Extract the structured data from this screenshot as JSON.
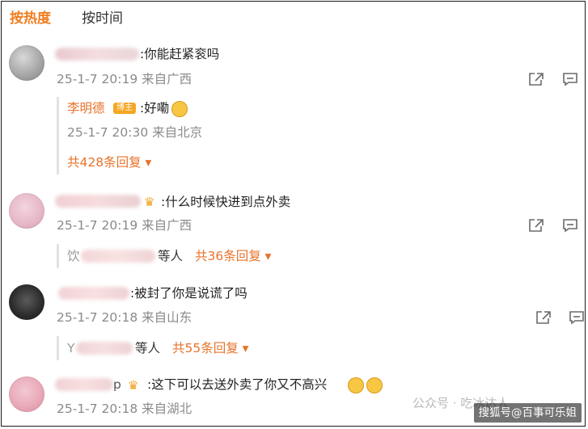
{
  "tabs": {
    "hot": "按热度",
    "time": "按时间"
  },
  "comments": [
    {
      "text": ":你能赶紧衮吗",
      "meta": "25-1-7 20:19 来自广西",
      "reply": {
        "name": "李明德",
        "badge": "博主",
        "text": ":好嘞",
        "meta": "25-1-7 20:30 来自北京",
        "count": "共428条回复 ▾"
      }
    },
    {
      "text": ":什么时候快进到点外卖",
      "meta": "25-1-7 20:19 来自广西",
      "others_prefix": "饮",
      "others": "等人",
      "count": "共36条回复 ▾"
    },
    {
      "text": ":被封了你是说谎了吗",
      "meta": "25-1-7 20:18 来自山东",
      "others_prefix": "Y",
      "others": "等人",
      "count": "共55条回复 ▾"
    },
    {
      "name_tail": "p",
      "text": ":这下可以去送外卖了你又不高兴",
      "meta": "25-1-7 20:18 来自湖北"
    }
  ],
  "watermarks": {
    "wechat": "公众号 · 吃冰达人",
    "sohu": "搜狐号@百事可乐姐"
  },
  "colors": {
    "accent": "#f07d1f",
    "reply_orange": "#e8722a",
    "meta_gray": "#8a8a8a"
  }
}
